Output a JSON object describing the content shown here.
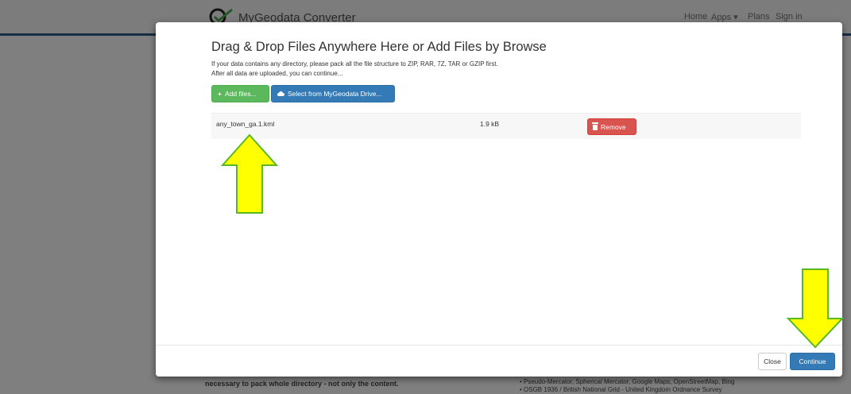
{
  "background": {
    "brand": "MyGeodata Converter",
    "nav": [
      "Home",
      "Apps ▾",
      "Plans",
      "Sign in"
    ],
    "text_left": "necessary to pack whole directory - not only the content.",
    "text_right_1": "• Pseudo-Mercator, Spherical Mercator, Google Maps, OpenStreetMap, Bing",
    "text_right_2": "• OSGB 1936 / British National Grid - United Kingdom Ordnance Survey"
  },
  "modal": {
    "title": "Drag & Drop Files Anywhere Here or Add Files by Browse",
    "line1": "If your data contains any directory, please pack all the file structure to ZIP, RAR, 7Z, TAR or GZIP first.",
    "line2": "After all data are uploaded, you can continue...",
    "add_files_label": "Add files...",
    "add_files_icon": "+",
    "drive_label": "Select from MyGeodata Drive...",
    "files": [
      {
        "name": "any_town_ga.1.kml",
        "size": "1.9 kB",
        "remove_label": "Remove"
      }
    ],
    "close_label": "Close",
    "continue_label": "Continue"
  },
  "annotations": {
    "arrow_color": "#ffff00",
    "arrow_outline": "#58b822",
    "arrows": [
      "up-arrow-to-file",
      "down-arrow-to-continue"
    ]
  },
  "colors": {
    "primary": "#337ab7",
    "success": "#5cb85c",
    "danger": "#d9534f",
    "nav_accent": "#2c5d8a"
  }
}
